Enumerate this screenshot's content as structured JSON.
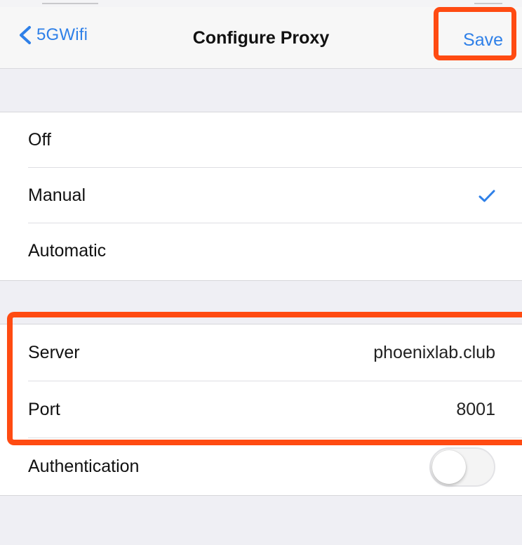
{
  "nav": {
    "back_label": "5GWifi",
    "title": "Configure Proxy",
    "save_label": "Save"
  },
  "proxy_modes": {
    "options": [
      {
        "label": "Off",
        "selected": false
      },
      {
        "label": "Manual",
        "selected": true
      },
      {
        "label": "Automatic",
        "selected": false
      }
    ]
  },
  "proxy_settings": {
    "server_label": "Server",
    "server_value": "phoenixlab.club",
    "port_label": "Port",
    "port_value": "8001",
    "authentication_label": "Authentication",
    "authentication_enabled": false
  },
  "colors": {
    "accent": "#2f80e8",
    "highlight": "#ff4b12",
    "background": "#efeff4"
  },
  "icons": {
    "back": "chevron-left-icon",
    "selected": "checkmark-icon"
  }
}
